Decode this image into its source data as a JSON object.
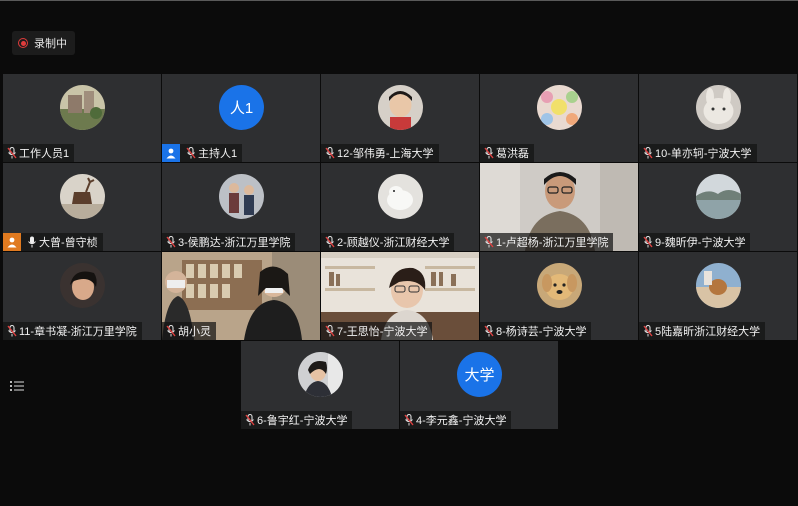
{
  "recording": {
    "label": "录制中",
    "color": "#e03c3c"
  },
  "colors": {
    "tile_bg": "#2e2f31",
    "app_bg": "#0b0b0b",
    "host_badge": "#1a73e8",
    "cohost_badge": "#e07a20"
  },
  "participants": [
    {
      "name": "工作人员1",
      "avatar": "campus-photo"
    },
    {
      "name": "主持人1",
      "avatar_text": "人1",
      "role": "host"
    },
    {
      "name": "12-邹伟勇-上海大学",
      "avatar": "child-photo"
    },
    {
      "name": "葛洪磊",
      "avatar": "flower-photo"
    },
    {
      "name": "10-单亦轲-宁波大学",
      "avatar": "rabbit-photo"
    },
    {
      "name": "大曾-曾守桢",
      "avatar": "deer-sculpture-photo",
      "role": "cohost",
      "mic": "active"
    },
    {
      "name": "3-侯鹏达-浙江万里学院",
      "avatar": "people-photo"
    },
    {
      "name": "2-顾越仪-浙江财经大学",
      "avatar": "white-dog-photo"
    },
    {
      "name": "1-卢超杨-浙江万里学院",
      "video": "man-glasses"
    },
    {
      "name": "9-魏昕伊-宁波大学",
      "avatar": "lake-photo"
    },
    {
      "name": "11-章书凝-浙江万里学院",
      "avatar": "girl-photo"
    },
    {
      "name": "胡小灵",
      "video": "bookshelf-two-people"
    },
    {
      "name": "7-王思怡-宁波大学",
      "video": "bookshelf-girl"
    },
    {
      "name": "8-杨诗芸-宁波大学",
      "avatar": "golden-dog-photo"
    },
    {
      "name": "5陆嘉昕浙江财经大学",
      "avatar": "dog-beach-photo"
    },
    {
      "name": "6-鲁宇红-宁波大学",
      "avatar": "woman-room-photo"
    },
    {
      "name": "4-李元鑫-宁波大学",
      "avatar_text": "大学"
    }
  ],
  "sidebar": {
    "list_icon": "participant-list-icon"
  }
}
